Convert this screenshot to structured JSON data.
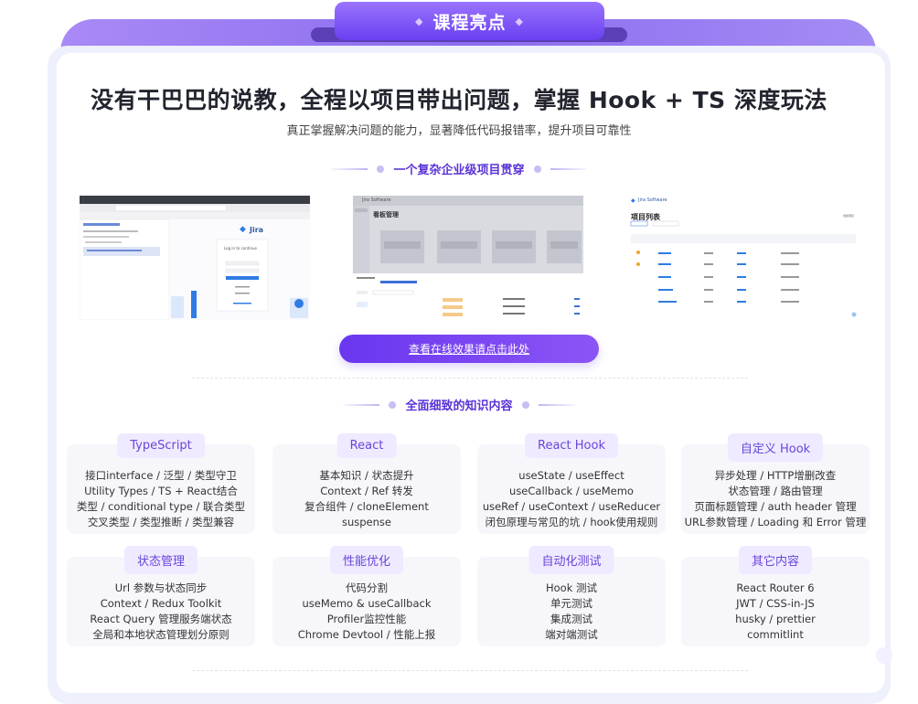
{
  "header": {
    "tab_label": "课程亮点",
    "tab_left_dot": "◆",
    "tab_right_dot": "◆"
  },
  "headline": "没有干巴巴的说教，全程以项目带出问题，掌握 Hook + TS 深度玩法",
  "subline": "真正掌握解决问题的能力，显著降低代码报错率，提升项目可靠性",
  "project_section": {
    "title": "一个复杂企业级项目贯穿"
  },
  "screenshots": {
    "login": {
      "brand": "Jira",
      "form_title": "Log in to continue",
      "button": "登录",
      "link1": "注册账号",
      "link2": "没有账号？注册新账号"
    },
    "board": {
      "brand": "Jira Software",
      "page_title": "看板管理",
      "cols": [
        "待完成",
        "开发中",
        "已完成",
        "测试中"
      ]
    },
    "list": {
      "brand": "Jira Software",
      "page_title": "项目列表",
      "button": "创建项目",
      "headers": [
        "名称",
        "部门",
        "负责人",
        "创建时间"
      ]
    }
  },
  "cta": {
    "label": "查看在线效果请点击此处"
  },
  "knowledge_section": {
    "title": "全面细致的知识内容"
  },
  "cards": [
    {
      "title": "TypeScript",
      "lines": [
        "接口interface / 泛型 / 类型守卫",
        "Utility Types / TS + React结合",
        "类型 / conditional type / 联合类型",
        "交叉类型 / 类型推断 / 类型兼容"
      ]
    },
    {
      "title": "React",
      "lines": [
        "基本知识 / 状态提升",
        "Context / Ref 转发",
        "复合组件 / cloneElement",
        "suspense"
      ]
    },
    {
      "title": "React Hook",
      "lines": [
        "useState / useEffect",
        "useCallback / useMemo",
        "useRef / useContext / useReducer",
        "闭包原理与常见的坑 / hook使用规则"
      ]
    },
    {
      "title": "自定义 Hook",
      "lines": [
        "异步处理 / HTTP增删改查",
        "状态管理 / 路由管理",
        "页面标题管理 / auth header 管理",
        "URL参数管理 / Loading 和 Error 管理"
      ]
    },
    {
      "title": "状态管理",
      "lines": [
        "Url 参数与状态同步",
        "Context / Redux Toolkit",
        "React Query 管理服务端状态",
        "全局和本地状态管理划分原则"
      ]
    },
    {
      "title": "性能优化",
      "lines": [
        "代码分割",
        "useMemo & useCallback",
        "Profiler监控性能",
        "Chrome Devtool / 性能上报"
      ]
    },
    {
      "title": "自动化测试",
      "lines": [
        "Hook 测试",
        "单元测试",
        "集成测试",
        "端对端测试"
      ]
    },
    {
      "title": "其它内容",
      "lines": [
        "React Router 6",
        "JWT / CSS-in-JS",
        "husky / prettier",
        "commitlint"
      ]
    }
  ],
  "colors": {
    "accent": "#6a36ef",
    "accent_light": "#efeaff",
    "band": "#8a6cf0"
  }
}
